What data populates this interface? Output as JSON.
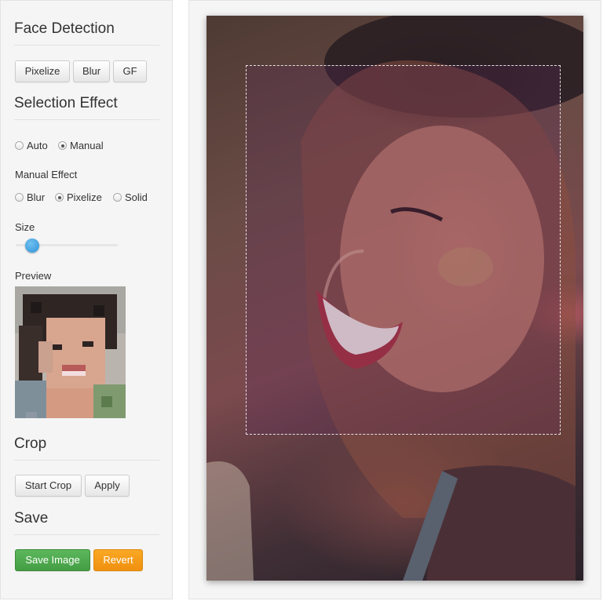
{
  "face_detection": {
    "title": "Face Detection",
    "buttons": [
      "Pixelize",
      "Blur",
      "GF"
    ]
  },
  "selection_effect": {
    "title": "Selection Effect",
    "mode_options": [
      {
        "label": "Auto",
        "checked": false
      },
      {
        "label": "Manual",
        "checked": true
      }
    ],
    "manual_effect_label": "Manual Effect",
    "effect_options": [
      {
        "label": "Blur",
        "checked": false
      },
      {
        "label": "Pixelize",
        "checked": true
      },
      {
        "label": "Solid",
        "checked": false
      }
    ],
    "size_label": "Size",
    "size_value": 0.17,
    "preview_label": "Preview"
  },
  "crop": {
    "title": "Crop",
    "start_label": "Start Crop",
    "apply_label": "Apply"
  },
  "save": {
    "title": "Save",
    "save_label": "Save Image",
    "revert_label": "Revert"
  },
  "colors": {
    "accent_blue": "#2e92d8",
    "save_green": "#5cb85c",
    "revert_orange": "#f9a825"
  },
  "icons": {
    "slider_thumb": "circle-handle-icon"
  }
}
